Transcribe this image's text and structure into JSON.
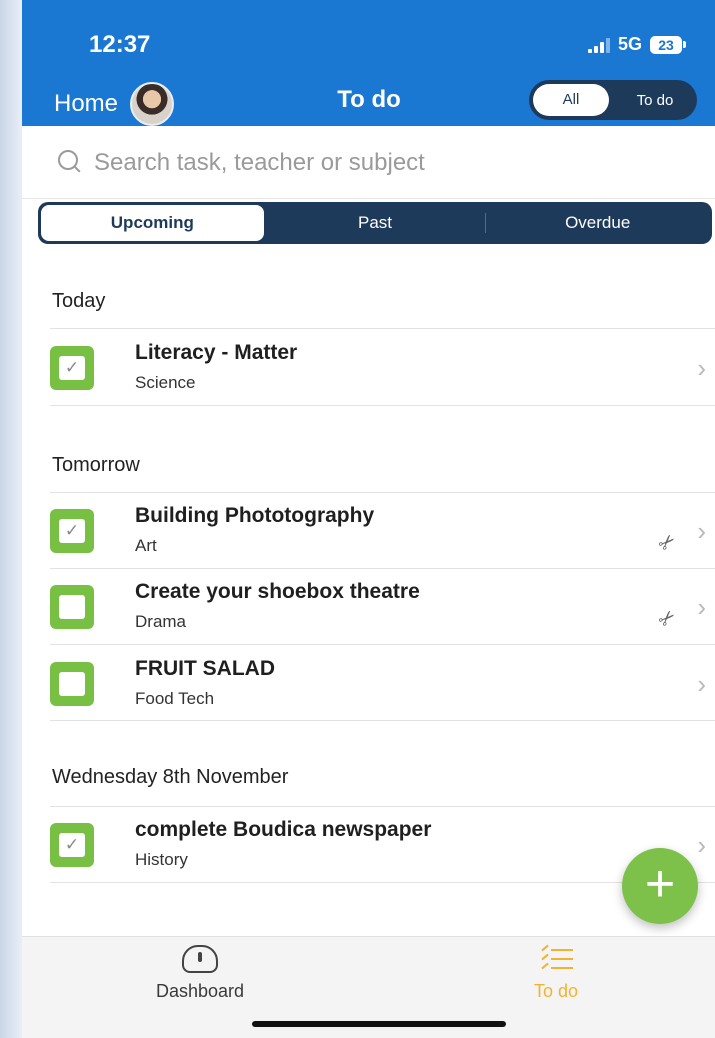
{
  "status": {
    "time": "12:37",
    "network": "5G",
    "battery": "23"
  },
  "header": {
    "home_label": "Home",
    "title": "To do",
    "filter_all": "All",
    "filter_todo": "To do"
  },
  "search": {
    "placeholder": "Search task, teacher or subject"
  },
  "segments": {
    "upcoming": "Upcoming",
    "past": "Past",
    "overdue": "Overdue"
  },
  "sections": [
    {
      "label": "Today",
      "tasks": [
        {
          "title": "Literacy - Matter",
          "subject": "Science",
          "checked": true,
          "attachment": false
        }
      ]
    },
    {
      "label": "Tomorrow",
      "tasks": [
        {
          "title": "Building Phototography",
          "subject": "Art",
          "checked": true,
          "attachment": true
        },
        {
          "title": "Create your shoebox theatre",
          "subject": "Drama",
          "checked": false,
          "attachment": true
        },
        {
          "title": "FRUIT SALAD",
          "subject": "Food Tech",
          "checked": false,
          "attachment": false
        }
      ]
    },
    {
      "label": "Wednesday 8th November",
      "tasks": [
        {
          "title": "complete Boudica newspaper",
          "subject": "History",
          "checked": true,
          "attachment": false
        }
      ]
    }
  ],
  "bottom_tabs": {
    "dashboard": "Dashboard",
    "todo": "To do"
  },
  "icons": {
    "check": "✓",
    "chevron": "›",
    "plus": "+"
  },
  "colors": {
    "header_blue": "#1a77d2",
    "segment_navy": "#1e3a5a",
    "task_green": "#78c044",
    "tab_active": "#f3b331"
  }
}
